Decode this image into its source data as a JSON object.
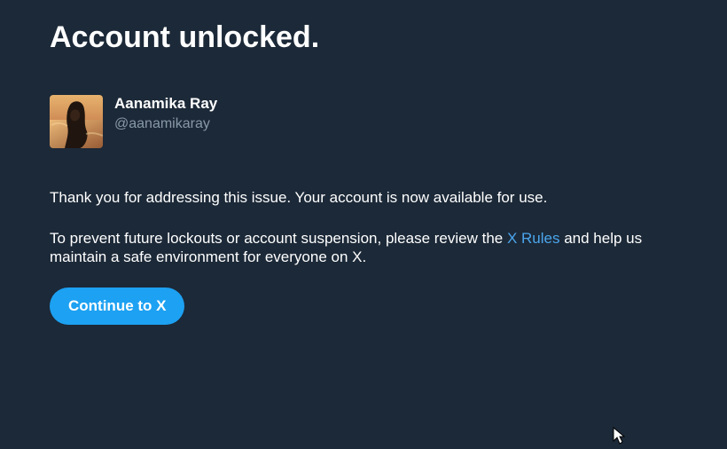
{
  "header": {
    "title": "Account unlocked."
  },
  "profile": {
    "display_name": "Aanamika Ray",
    "handle": "@aanamikaray"
  },
  "message": {
    "line1": "Thank you for addressing this issue. Your account is now available for use.",
    "line2_before": "To prevent future lockouts or account suspension, please review the ",
    "rules_link": "X Rules",
    "line2_after": " and help us maintain a safe environment for everyone on X."
  },
  "actions": {
    "continue_label": "Continue to X"
  },
  "colors": {
    "background": "#1c2938",
    "primary_text": "#ffffff",
    "secondary_text": "#8899a6",
    "link": "#4aa5ec",
    "button": "#1da1f2"
  },
  "icons": {
    "cursor": "mouse-pointer-icon"
  }
}
